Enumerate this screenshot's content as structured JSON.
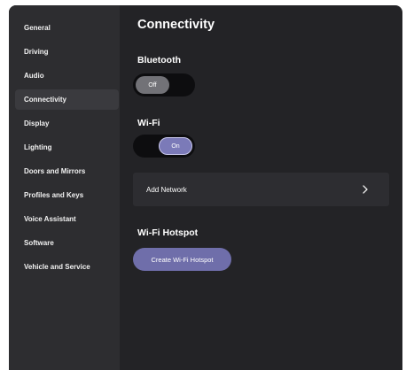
{
  "sidebar": {
    "items": [
      {
        "label": "General"
      },
      {
        "label": "Driving"
      },
      {
        "label": "Audio"
      },
      {
        "label": "Connectivity",
        "active": true
      },
      {
        "label": "Display"
      },
      {
        "label": "Lighting"
      },
      {
        "label": "Doors and Mirrors"
      },
      {
        "label": "Profiles and Keys"
      },
      {
        "label": "Voice Assistant"
      },
      {
        "label": "Software"
      },
      {
        "label": "Vehicle and Service"
      }
    ]
  },
  "main": {
    "title": "Connectivity",
    "bluetooth": {
      "label": "Bluetooth",
      "toggle_text": "Off",
      "state": "off"
    },
    "wifi": {
      "label": "Wi-Fi",
      "toggle_text": "On",
      "state": "on"
    },
    "add_network": {
      "label": "Add Network",
      "icon": "chevron-right-icon"
    },
    "hotspot": {
      "label": "Wi-Fi Hotspot",
      "button_label": "Create Wi-Fi Hotspot"
    }
  },
  "colors": {
    "background": "#232326",
    "sidebar": "#2d2d30",
    "accent": "#7b7ab8"
  }
}
